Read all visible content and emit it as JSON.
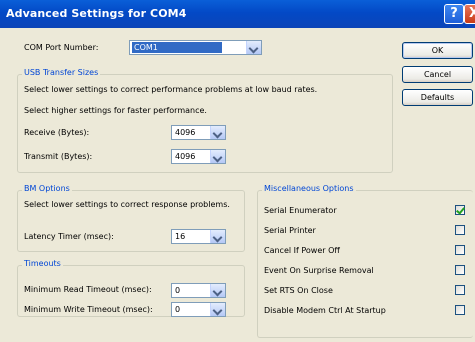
{
  "window": {
    "title": "Advanced Settings for COM4",
    "help_icon": "?",
    "close_icon": "X"
  },
  "com_port": {
    "label": "COM Port Number:",
    "value": "COM1"
  },
  "buttons": {
    "ok": "OK",
    "cancel": "Cancel",
    "defaults": "Defaults"
  },
  "usb": {
    "title": "USB Transfer Sizes",
    "desc1": "Select lower settings to correct performance problems at low baud rates.",
    "desc2": "Select higher settings for faster performance.",
    "receive_label": "Receive (Bytes):",
    "receive_value": "4096",
    "transmit_label": "Transmit (Bytes):",
    "transmit_value": "4096"
  },
  "bm": {
    "title": "BM Options",
    "desc": "Select lower settings to correct response problems.",
    "latency_label": "Latency Timer (msec):",
    "latency_value": "16"
  },
  "timeouts": {
    "title": "Timeouts",
    "min_read_label": "Minimum Read Timeout (msec):",
    "min_read_value": "0",
    "min_write_label": "Minimum Write Timeout (msec):",
    "min_write_value": "0"
  },
  "misc": {
    "title": "Miscellaneous Options",
    "options": [
      {
        "label": "Serial Enumerator",
        "checked": true
      },
      {
        "label": "Serial Printer",
        "checked": false
      },
      {
        "label": "Cancel If Power Off",
        "checked": false
      },
      {
        "label": "Event On Surprise Removal",
        "checked": false
      },
      {
        "label": "Set RTS On Close",
        "checked": false
      },
      {
        "label": "Disable Modem Ctrl At Startup",
        "checked": false
      }
    ]
  }
}
